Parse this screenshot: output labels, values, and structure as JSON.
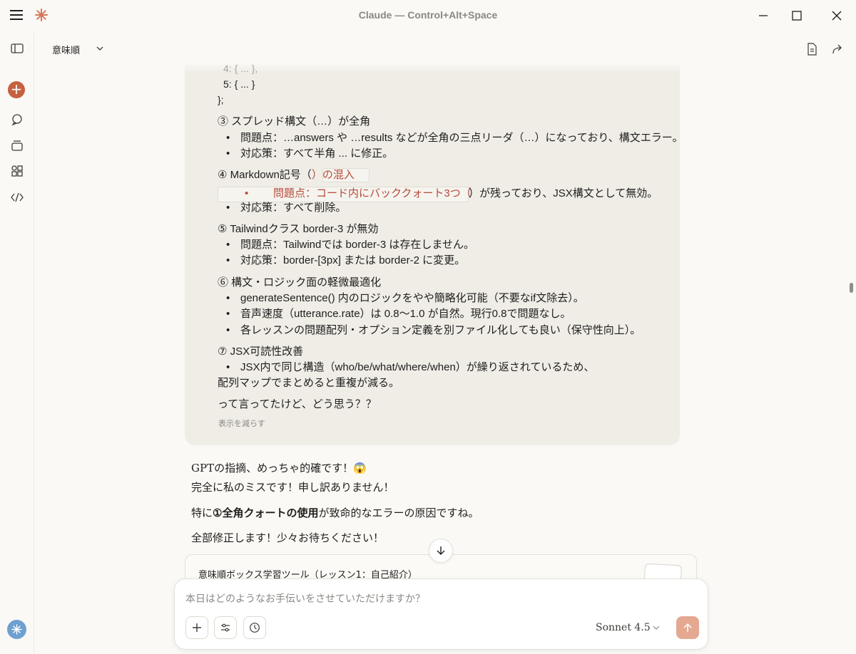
{
  "window": {
    "title": "Claude — Control+Alt+Space"
  },
  "header": {
    "project": "意味順"
  },
  "user_message": {
    "code_lines": [
      "4: { ... },",
      "5: { ... }",
      "};"
    ],
    "items": [
      {
        "heading": "③ スプレッド構文（…）が全角",
        "bullets": [
          "問題点：…answers や …results などが全角の三点リーダ（…）になっており、構文エラー。",
          "対応策：すべて半角 ... に修正。"
        ]
      },
      {
        "heading": "④ Markdown記号（",
        "heading_quote": "）の混入",
        "quoted_bullet": "問題点：コード内にバッククォート3つ（",
        "quoted_tail": "）が残っており、JSX構文として無効。",
        "bullets": [
          "対応策：すべて削除。"
        ]
      },
      {
        "heading": "⑤ Tailwindクラス border-3 が無効",
        "bullets": [
          "問題点：Tailwindでは border-3 は存在しません。",
          "対応策：border-[3px] または border-2 に変更。"
        ]
      },
      {
        "heading": "⑥ 構文・ロジック面の軽微最適化",
        "bullets": [
          "generateSentence() 内のロジックをやや簡略化可能（不要なif文除去）。",
          "音声速度（utterance.rate）は 0.8〜1.0 が自然。現行0.8で問題なし。",
          "各レッスンの問題配列・オプション定義を別ファイル化しても良い（保守性向上）。"
        ]
      },
      {
        "heading": "⑦ JSX可読性改善",
        "bullets": [
          "JSX内で同じ構造（who/be/what/where/when）が繰り返されているため、"
        ],
        "continuation": "配列マップでまとめると重複が減る。"
      }
    ],
    "closing": "って言ってたけど、どう思う？？",
    "show_less": "表示を減らす"
  },
  "assistant_reply": {
    "line1": "GPTの指摘、めっちゃ的確です！😱",
    "line2": "完全に私のミスです！申し訳ありません！",
    "line3_prefix": "特に",
    "line3_bold": "①全角クォートの使用",
    "line3_suffix": "が致命的なエラーの原因ですね。",
    "line4": "全部修正します！少々お待ちください！"
  },
  "artifact": {
    "title": "意味順ボックス学習ツール（レッスン1：自己紹介）"
  },
  "composer": {
    "placeholder": "本日はどのようなお手伝いをさせていただけますか？",
    "model": "Sonnet 4.5"
  },
  "colors": {
    "accent": "#c6613f",
    "send_button": "#e5a891",
    "bubble_bg": "#efede6"
  }
}
